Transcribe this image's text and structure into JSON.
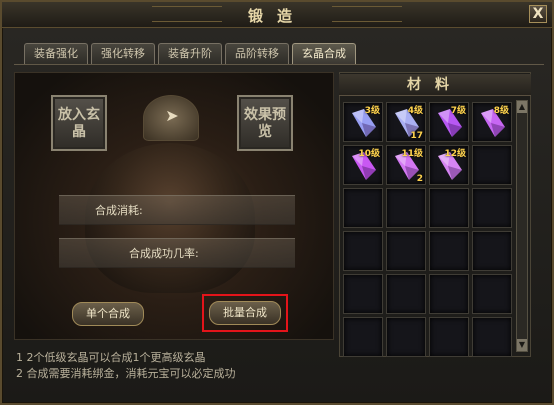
{
  "window": {
    "title": "锻造",
    "close_label": "X"
  },
  "tabs": [
    {
      "label": "装备强化",
      "active": false
    },
    {
      "label": "强化转移",
      "active": false
    },
    {
      "label": "装备升阶",
      "active": false
    },
    {
      "label": "品阶转移",
      "active": false
    },
    {
      "label": "玄晶合成",
      "active": true
    }
  ],
  "forge": {
    "input_slot": "放入玄晶",
    "preview_slot": "效果预览",
    "cost_label": "合成消耗:",
    "rate_label": "合成成功几率:",
    "single_button": "单个合成",
    "batch_button": "批量合成"
  },
  "materials": {
    "title": "材料",
    "items": [
      {
        "level": "3级",
        "count": "",
        "color": "#9fa6ff"
      },
      {
        "level": "4级",
        "count": "17",
        "color": "#b2b8ff"
      },
      {
        "level": "7级",
        "count": "",
        "color": "#c05cff"
      },
      {
        "level": "8级",
        "count": "",
        "color": "#d16cff"
      },
      {
        "level": "10级",
        "count": "",
        "color": "#d35cff"
      },
      {
        "level": "11级",
        "count": "2",
        "color": "#dd7cff"
      },
      {
        "level": "12级",
        "count": "",
        "color": "#e08aff"
      }
    ]
  },
  "notes": [
    "1  2个低级玄晶可以合成1个更高级玄晶",
    "2  合成需要消耗绑金，消耗元宝可以必定成功"
  ],
  "colors": {
    "highlight": "#e4141a",
    "accent": "#ffd34e"
  }
}
